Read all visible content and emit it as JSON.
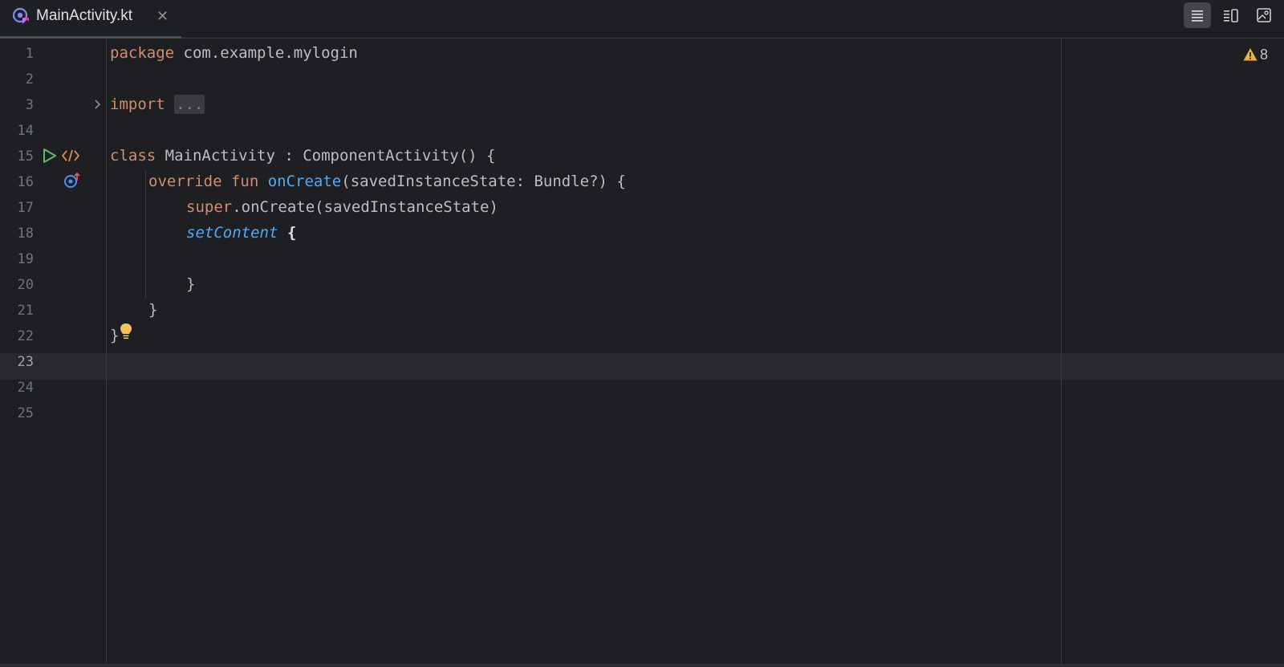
{
  "tab": {
    "title": "MainActivity.kt",
    "close": "✕",
    "icon": "kotlin-file-icon"
  },
  "toolbar": {
    "buttons": [
      "code-view-icon",
      "split-view-icon",
      "design-view-icon"
    ],
    "active": "code-view-icon"
  },
  "warnings": {
    "count": "8",
    "icon": "warning-icon",
    "color": "#e8b33a"
  },
  "gutter": {
    "line_numbers": [
      "1",
      "2",
      "3",
      "14",
      "15",
      "16",
      "17",
      "18",
      "19",
      "20",
      "21",
      "22",
      "23",
      "24",
      "25"
    ],
    "current_line": "23",
    "icons": [
      "fold-chevron-icon",
      "run-icon",
      "code-preview-icon",
      "override-icon",
      "lightbulb-icon"
    ]
  },
  "code": {
    "l1_kw": "package",
    "l1_pkg": " com.example.mylogin",
    "l3_kw": "import",
    "l3_fold": "...",
    "l15_kw": "class",
    "l15_rest": " MainActivity : ComponentActivity() {",
    "l16_kw": "override fun",
    "l16_fn": "onCreate",
    "l16_rest": "(savedInstanceState: Bundle?) {",
    "l17_kw": "super",
    "l17_rest": ".onCreate(savedInstanceState)",
    "l18_fn": "setContent",
    "l18_brace": "{",
    "l20": "}",
    "l21": "}",
    "l22": "}"
  },
  "colors": {
    "background": "#1e1f22",
    "keyword": "#cf8e6d",
    "function": "#56a8f5",
    "text": "#bcbec4"
  }
}
